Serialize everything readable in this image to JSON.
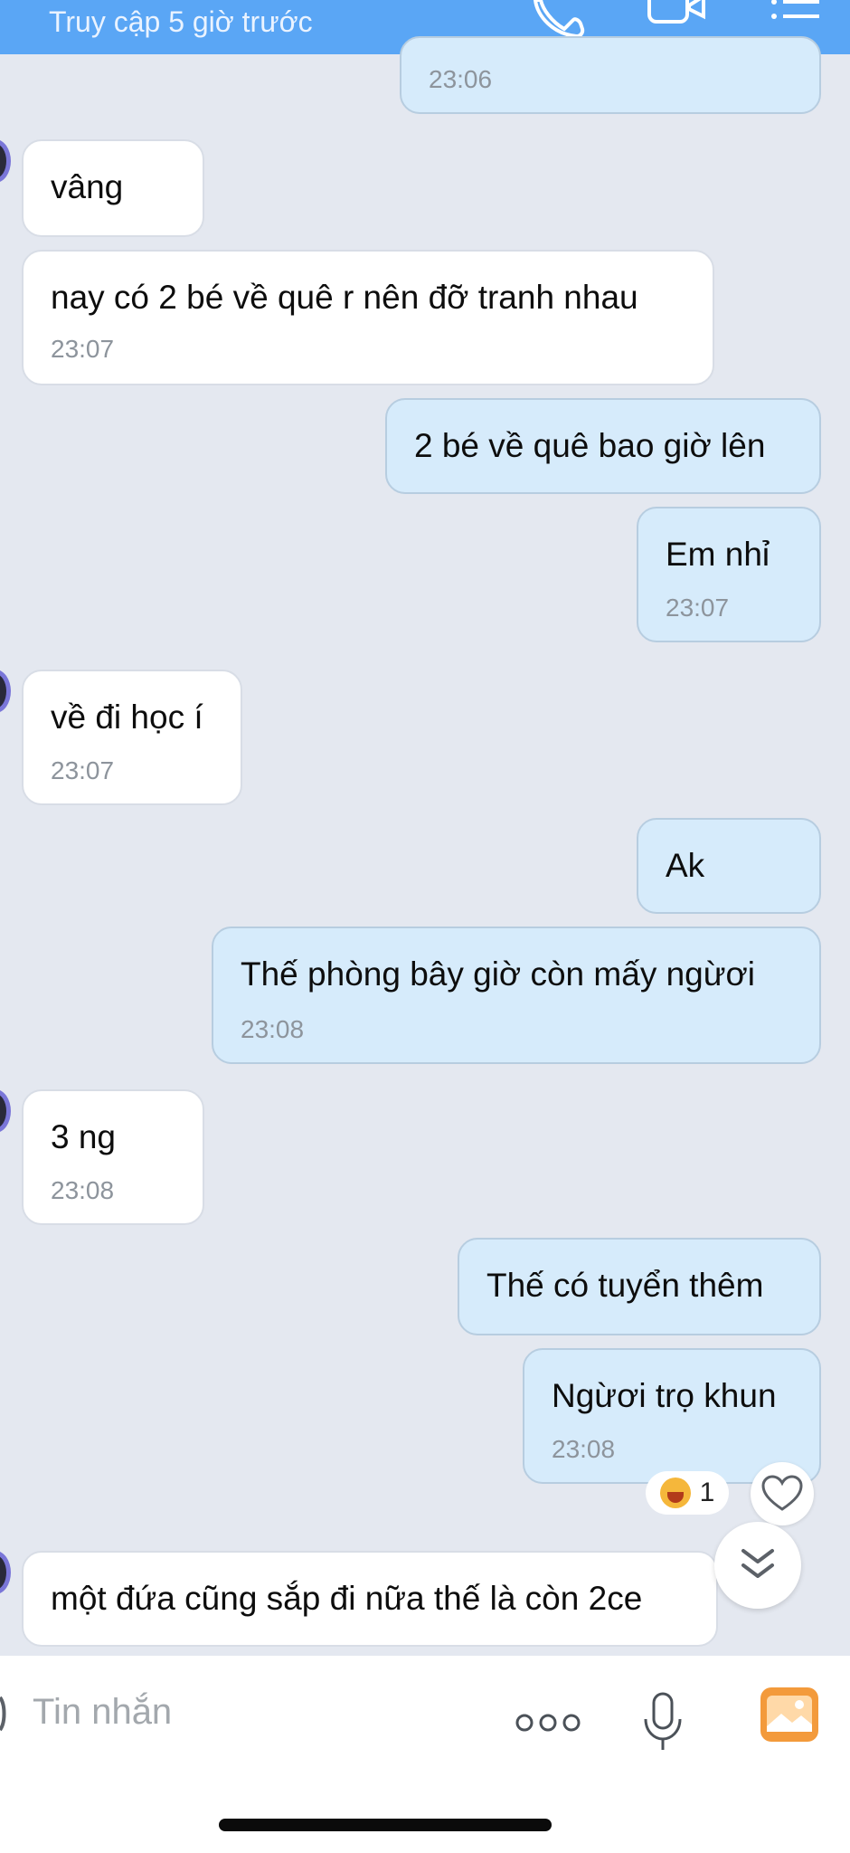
{
  "header": {
    "subtitle": "Truy cập 5 giờ trước",
    "icons": [
      "phone-icon",
      "video-call-icon",
      "menu-icon"
    ]
  },
  "colors": {
    "header_bg": "#5aa6f5",
    "chat_bg": "#e4e8f0",
    "incoming_bubble": "#ffffff",
    "outgoing_bubble": "#d6ebfb",
    "image_button": "#f39a3b"
  },
  "messages": [
    {
      "dir": "out",
      "text": "",
      "time": "23:06"
    },
    {
      "dir": "in",
      "text": "vâng",
      "time": ""
    },
    {
      "dir": "in",
      "text": "nay có 2 bé về quê r nên đỡ tranh nhau",
      "time": "23:07"
    },
    {
      "dir": "out",
      "text": "2 bé về quê bao giờ lên",
      "time": ""
    },
    {
      "dir": "out",
      "text": "Em nhỉ",
      "time": "23:07"
    },
    {
      "dir": "in",
      "text": "về đi học í",
      "time": "23:07"
    },
    {
      "dir": "out",
      "text": "Ak",
      "time": ""
    },
    {
      "dir": "out",
      "text": "Thế phòng bây giờ còn mấy ngừơi",
      "time": "23:08"
    },
    {
      "dir": "in",
      "text": "3 ng",
      "time": "23:08"
    },
    {
      "dir": "out",
      "text": "Thế có tuyển thêm",
      "time": ""
    },
    {
      "dir": "out",
      "text": "Ngừơi trọ khun",
      "time": "23:08"
    },
    {
      "dir": "in",
      "text": "một đứa cũng sắp đi nữa thế là còn 2ce",
      "time": ""
    }
  ],
  "reaction": {
    "emoji": "laughing-face",
    "count": "1"
  },
  "composer": {
    "placeholder": "Tin nhắn",
    "icons": [
      "more-icon",
      "microphone-icon",
      "image-icon"
    ]
  }
}
